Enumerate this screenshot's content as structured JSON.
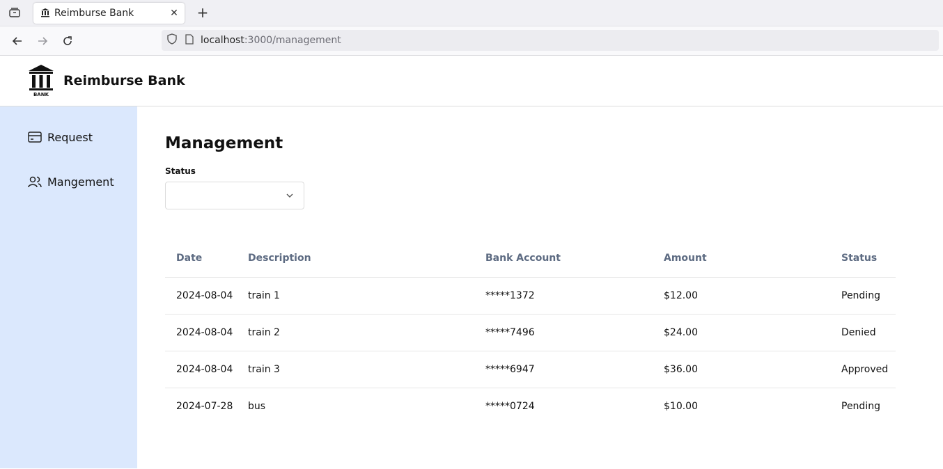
{
  "browser": {
    "tab_title": "Reimburse Bank",
    "url_host": "localhost",
    "url_rest": ":3000/management"
  },
  "header": {
    "brand": "Reimburse Bank",
    "logo_text": "BANK"
  },
  "sidebar": {
    "items": [
      {
        "label": "Request",
        "icon": "card-icon"
      },
      {
        "label": "Mangement",
        "icon": "users-icon"
      }
    ]
  },
  "main": {
    "title": "Management",
    "status_filter": {
      "label": "Status",
      "value": ""
    },
    "table": {
      "columns": [
        "Date",
        "Description",
        "Bank Account",
        "Amount",
        "Status"
      ],
      "rows": [
        [
          "2024-08-04",
          "train 1",
          "*****1372",
          "$12.00",
          "Pending"
        ],
        [
          "2024-08-04",
          "train 2",
          "*****7496",
          "$24.00",
          "Denied"
        ],
        [
          "2024-08-04",
          "train 3",
          "*****6947",
          "$36.00",
          "Approved"
        ],
        [
          "2024-07-28",
          "bus",
          "*****0724",
          "$10.00",
          "Pending"
        ]
      ]
    }
  },
  "colors": {
    "sidebar_bg": "#dbe8fd",
    "header_text": "#5d6b82"
  }
}
